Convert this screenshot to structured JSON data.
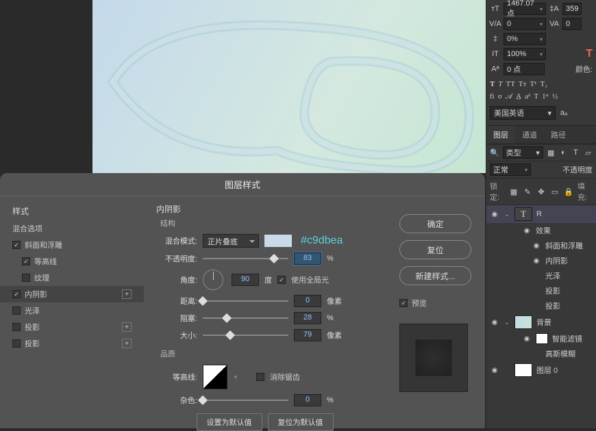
{
  "dialog": {
    "title": "图层样式",
    "styles_header": "样式",
    "blend_options": "混合选项",
    "items": [
      {
        "label": "斜面和浮雕",
        "checked": true
      },
      {
        "label": "等高线",
        "checked": true
      },
      {
        "label": "纹理",
        "checked": false
      },
      {
        "label": "内阴影",
        "checked": true,
        "plus": true,
        "selected": true
      },
      {
        "label": "光泽",
        "checked": false
      },
      {
        "label": "投影",
        "checked": false,
        "plus": true
      },
      {
        "label": "投影",
        "checked": false,
        "plus": true
      }
    ],
    "inner_shadow": {
      "title": "内阴影",
      "structure": "结构",
      "blend_mode_label": "混合模式:",
      "blend_mode": "正片叠底",
      "color_hex": "#c9dbea",
      "opacity_label": "不透明度:",
      "opacity": "83",
      "percent": "%",
      "angle_label": "角度:",
      "angle": "90",
      "degree": "度",
      "global_light": "使用全局光",
      "distance_label": "距离:",
      "distance": "0",
      "px": "像素",
      "choke_label": "阻塞:",
      "choke": "28",
      "size_label": "大小:",
      "size": "79",
      "quality": "品质",
      "contour_label": "等高线:",
      "anti_alias": "消除锯齿",
      "noise_label": "杂色:",
      "noise": "0",
      "set_default": "设置为默认值",
      "reset_default": "复位为默认值"
    },
    "actions": {
      "ok": "确定",
      "reset": "复位",
      "new_style": "新建样式...",
      "preview": "预览"
    }
  },
  "char_panel": {
    "font_size": "1467.07 点",
    "leading": "359",
    "tracking": "0",
    "vscale": "0%",
    "hscale": "100%",
    "baseline": "0 点",
    "color_label": "颜色:",
    "language": "美国英语"
  },
  "layers": {
    "tabs": [
      "图层",
      "通道",
      "路径"
    ],
    "filter": " 类型",
    "mode": "正常",
    "opacity_label": "不透明度",
    "lock": "锁定:",
    "fill": "填充:",
    "text_layer": "R",
    "fx": "效果",
    "fx_items": [
      "斜面和浮雕",
      "内阴影",
      "光泽",
      "投影",
      "投影"
    ],
    "bg": "背景",
    "smart_filter": "智能滤镜",
    "gaussian": "高斯模糊",
    "layer0": "图层 0"
  }
}
